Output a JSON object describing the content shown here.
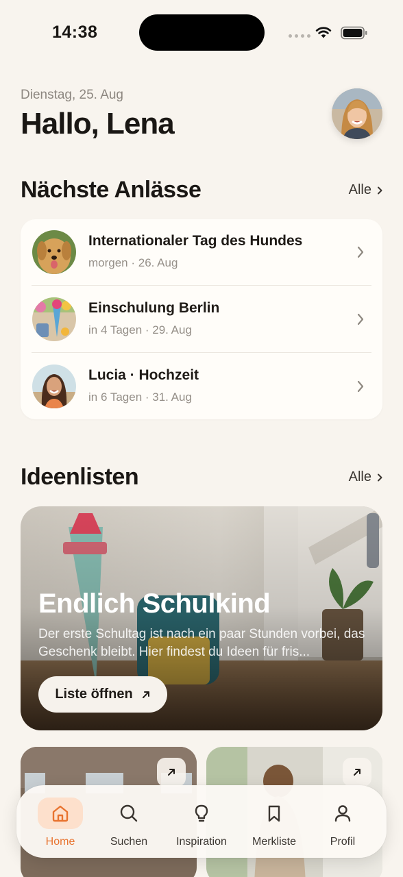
{
  "status_bar": {
    "time": "14:38"
  },
  "header": {
    "date": "Dienstag, 25. Aug",
    "greeting": "Hallo, Lena"
  },
  "events_section": {
    "title": "Nächste Anlässe",
    "link_label": "Alle",
    "items": [
      {
        "title": "Internationaler Tag des Hundes",
        "subtitle": "morgen · 26. Aug",
        "thumb": "dog-photo"
      },
      {
        "title": "Einschulung Berlin",
        "subtitle": "in 4 Tagen · 29. Aug",
        "thumb": "school-cone-photo"
      },
      {
        "title": "Lucia · Hochzeit",
        "subtitle": "in 6 Tagen · 31. Aug",
        "thumb": "lucia-photo"
      }
    ]
  },
  "ideas_section": {
    "title": "Ideenlisten",
    "link_label": "Alle",
    "hero": {
      "title": "Endlich Schulkind",
      "description": "Der erste Schultag ist nach ein paar Stunden vorbei, das Geschenk bleibt. Hier findest du Ideen für fris...",
      "button_label": "Liste öffnen"
    }
  },
  "tabbar": {
    "active": "Home",
    "accent_color": "#e8732f",
    "tabs": [
      {
        "label": "Home",
        "icon": "home-icon"
      },
      {
        "label": "Suchen",
        "icon": "search-icon"
      },
      {
        "label": "Inspiration",
        "icon": "lightbulb-icon"
      },
      {
        "label": "Merkliste",
        "icon": "bookmark-icon"
      },
      {
        "label": "Profil",
        "icon": "person-icon"
      }
    ]
  }
}
